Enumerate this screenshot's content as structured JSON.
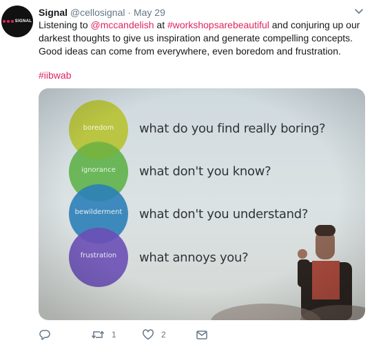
{
  "account": {
    "display_name": "Signal",
    "handle": "@cellosignal",
    "separator": "·",
    "date": "May 29",
    "avatar_text": "SIGNAL"
  },
  "tweet": {
    "part1": "Listening to ",
    "mention": "@mccandelish",
    "part2": " at ",
    "hashtag_inline": "#workshopsarebeautiful",
    "part3": " and conjuring up our darkest thoughts to give us inspiration and generate compelling concepts. Good ideas can come from everywhere, even boredom and frustration.",
    "hashtag": "#iibwab"
  },
  "slide": {
    "items": [
      {
        "label": "boredom",
        "question": "what do you find really boring?",
        "color": "#b8c43a"
      },
      {
        "label": "ignorance",
        "question": "what don't you know?",
        "color": "#5bb045"
      },
      {
        "label": "bewilderment",
        "question": "what don't you understand?",
        "color": "#2c7fb8"
      },
      {
        "label": "frustration",
        "question": "what annoys you?",
        "color": "#6a4fb5"
      }
    ]
  },
  "actions": {
    "reply_count": "",
    "retweet_count": "1",
    "like_count": "2"
  },
  "icons": {
    "reply": "reply-icon",
    "retweet": "retweet-icon",
    "like": "heart-icon",
    "dm": "envelope-icon",
    "more": "chevron-down-icon"
  },
  "colors": {
    "link": "#e0245e",
    "muted": "#657786"
  }
}
